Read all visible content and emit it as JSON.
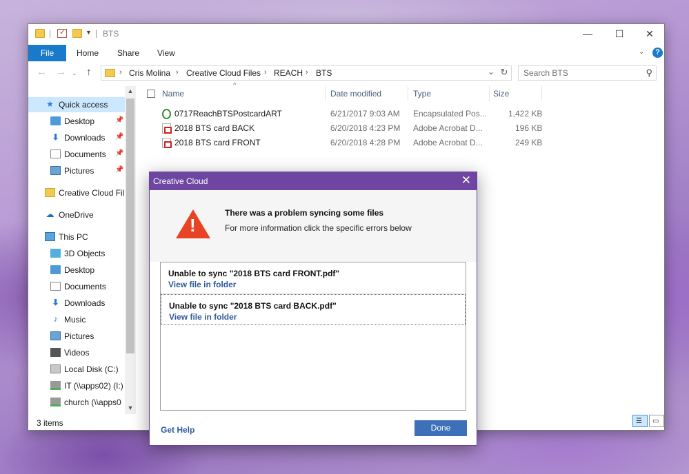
{
  "explorer": {
    "title": "BTS",
    "ribbon": {
      "file": "File",
      "tabs": [
        "Home",
        "Share",
        "View"
      ],
      "help": "?"
    },
    "address": {
      "segments": [
        "Cris Molina",
        "Creative Cloud Files",
        "REACH",
        "BTS"
      ]
    },
    "search": {
      "placeholder": "Search BTS"
    },
    "nav": {
      "quick_access": "Quick access",
      "quick_items": [
        "Desktop",
        "Downloads",
        "Documents",
        "Pictures"
      ],
      "creative_cloud": "Creative Cloud Fil",
      "onedrive": "OneDrive",
      "this_pc": "This PC",
      "pc_items": [
        "3D Objects",
        "Desktop",
        "Documents",
        "Downloads",
        "Music",
        "Pictures",
        "Videos",
        "Local Disk (C:)",
        "IT (\\\\apps02) (I:)",
        "church (\\\\apps0"
      ]
    },
    "columns": {
      "name": "Name",
      "date": "Date modified",
      "type": "Type",
      "size": "Size"
    },
    "files": [
      {
        "name": "0717ReachBTSPostcardART",
        "date": "6/21/2017 9:03 AM",
        "type": "Encapsulated Pos...",
        "size": "1,422 KB",
        "icon": "eps-icon"
      },
      {
        "name": "2018 BTS card BACK",
        "date": "6/20/2018 4:23 PM",
        "type": "Adobe Acrobat D...",
        "size": "196 KB",
        "icon": "pdf-icon"
      },
      {
        "name": "2018 BTS card FRONT",
        "date": "6/20/2018 4:28 PM",
        "type": "Adobe Acrobat D...",
        "size": "249 KB",
        "icon": "pdf-icon"
      }
    ],
    "status": "3 items"
  },
  "dialog": {
    "title": "Creative Cloud",
    "heading": "There was a problem syncing some files",
    "subheading": "For more information click the specific errors below",
    "errors": [
      {
        "message": "Unable to sync \"2018 BTS card FRONT.pdf\"",
        "link": "View file in folder"
      },
      {
        "message": "Unable to sync \"2018 BTS card BACK.pdf\"",
        "link": "View file in folder"
      }
    ],
    "help_link": "Get Help",
    "done": "Done"
  },
  "colors": {
    "accent": "#1979ca",
    "dialog_title": "#6e46a2",
    "warning": "#e74425",
    "link": "#2f5a9e",
    "done_button": "#3d70b8"
  }
}
